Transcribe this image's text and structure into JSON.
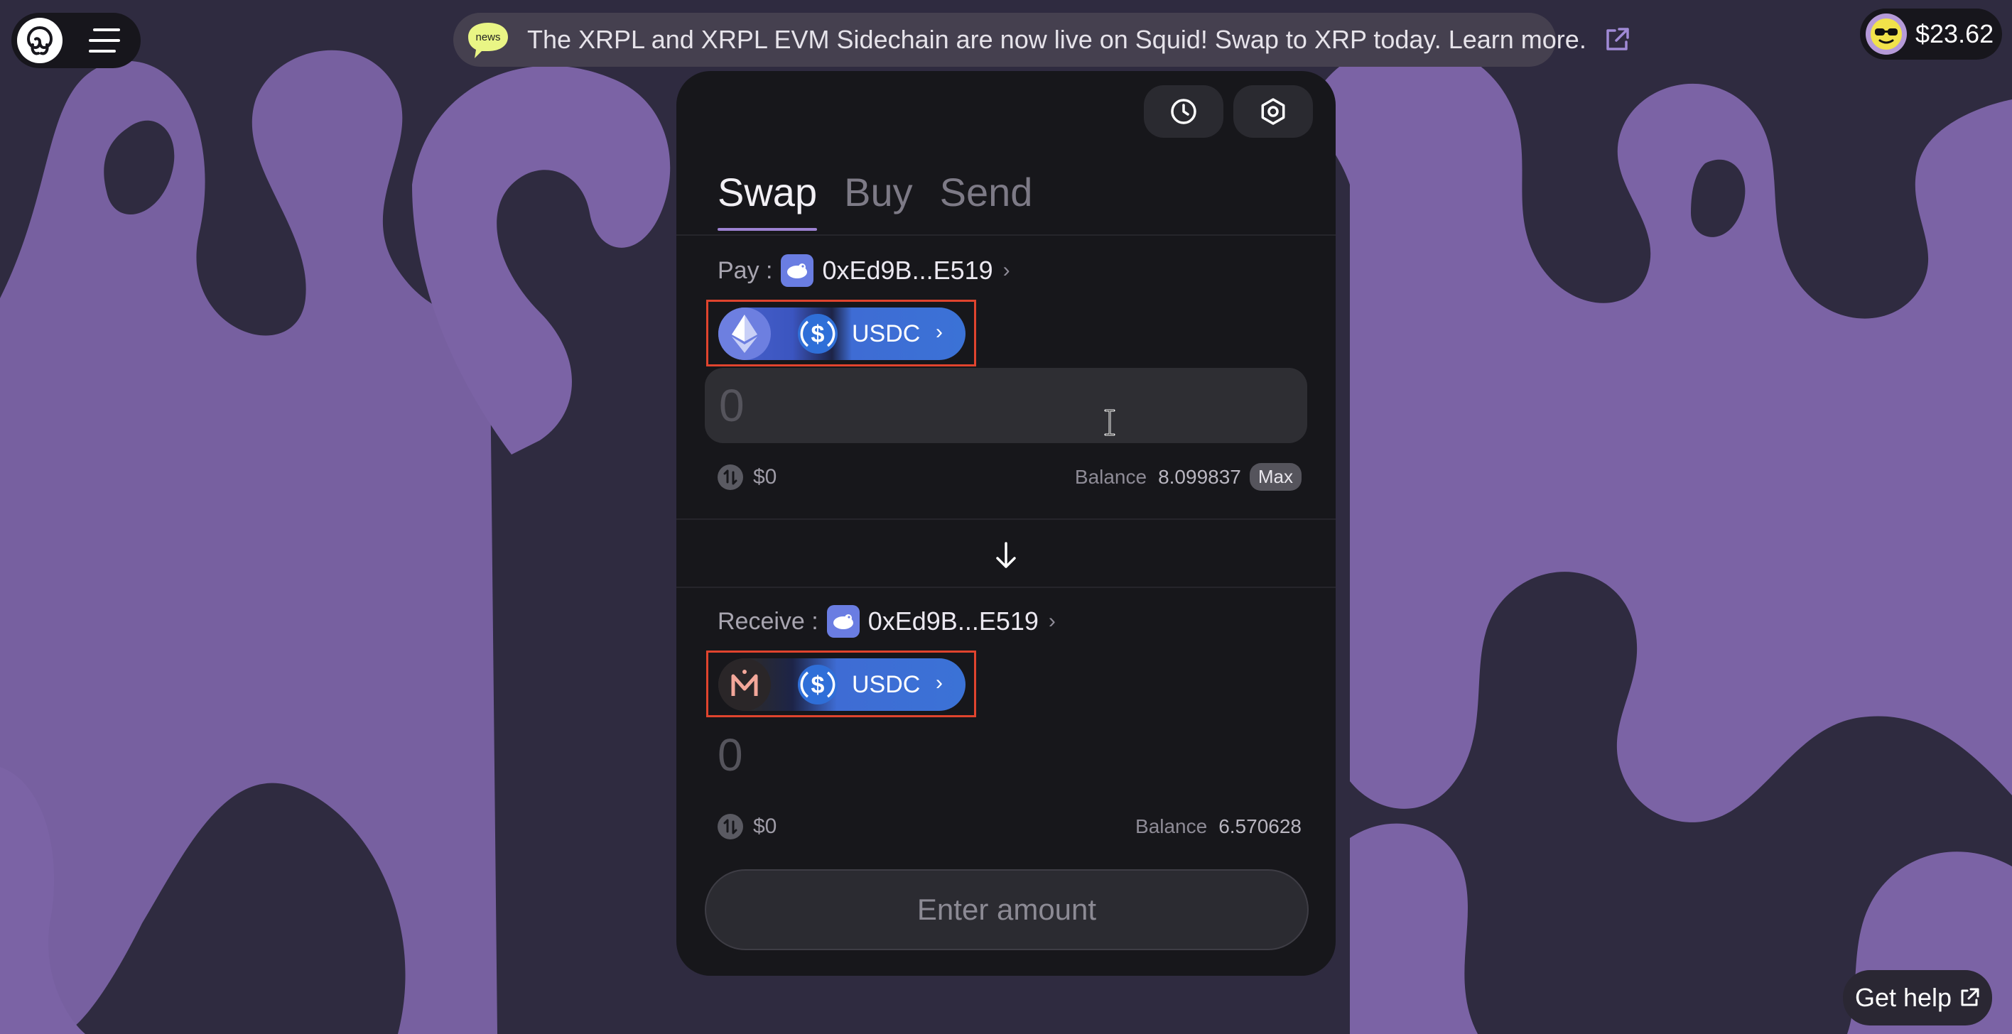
{
  "colors": {
    "background": "#2f2b40",
    "blob": "#7b63a5",
    "card": "#17171b",
    "accent": "#9d82d2",
    "highlight": "#e0442e"
  },
  "header": {
    "logo_icon": "squid-logo-icon",
    "menu_icon": "hamburger-menu-icon"
  },
  "news": {
    "badge": "news",
    "text": "The XRPL and XRPL EVM Sidechain are now live on Squid! Swap to XRP today. Learn more.",
    "link_icon": "external-link-icon"
  },
  "wallet": {
    "balance": "$23.62",
    "avatar_icon": "avatar-icon"
  },
  "toolbar": {
    "history_icon": "history-clock-icon",
    "settings_icon": "settings-gear-icon"
  },
  "tabs": [
    {
      "label": "Swap",
      "active": true
    },
    {
      "label": "Buy",
      "active": false
    },
    {
      "label": "Send",
      "active": false
    }
  ],
  "pay": {
    "label": "Pay :",
    "address": "0xEd9B...E519",
    "chain_icon": "ethereum-icon",
    "token": "USDC",
    "token_icon": "usdc-icon",
    "amount_placeholder": "0",
    "usd_value": "$0",
    "balance_label": "Balance",
    "balance_value": "8.099837",
    "max_label": "Max"
  },
  "receive": {
    "label": "Receive :",
    "address": "0xEd9B...E519",
    "chain_icon": "mantle-icon",
    "token": "USDC",
    "token_icon": "usdc-icon",
    "amount": "0",
    "usd_value": "$0",
    "balance_label": "Balance",
    "balance_value": "6.570628"
  },
  "cta": {
    "label": "Enter amount"
  },
  "help": {
    "label": "Get help"
  }
}
